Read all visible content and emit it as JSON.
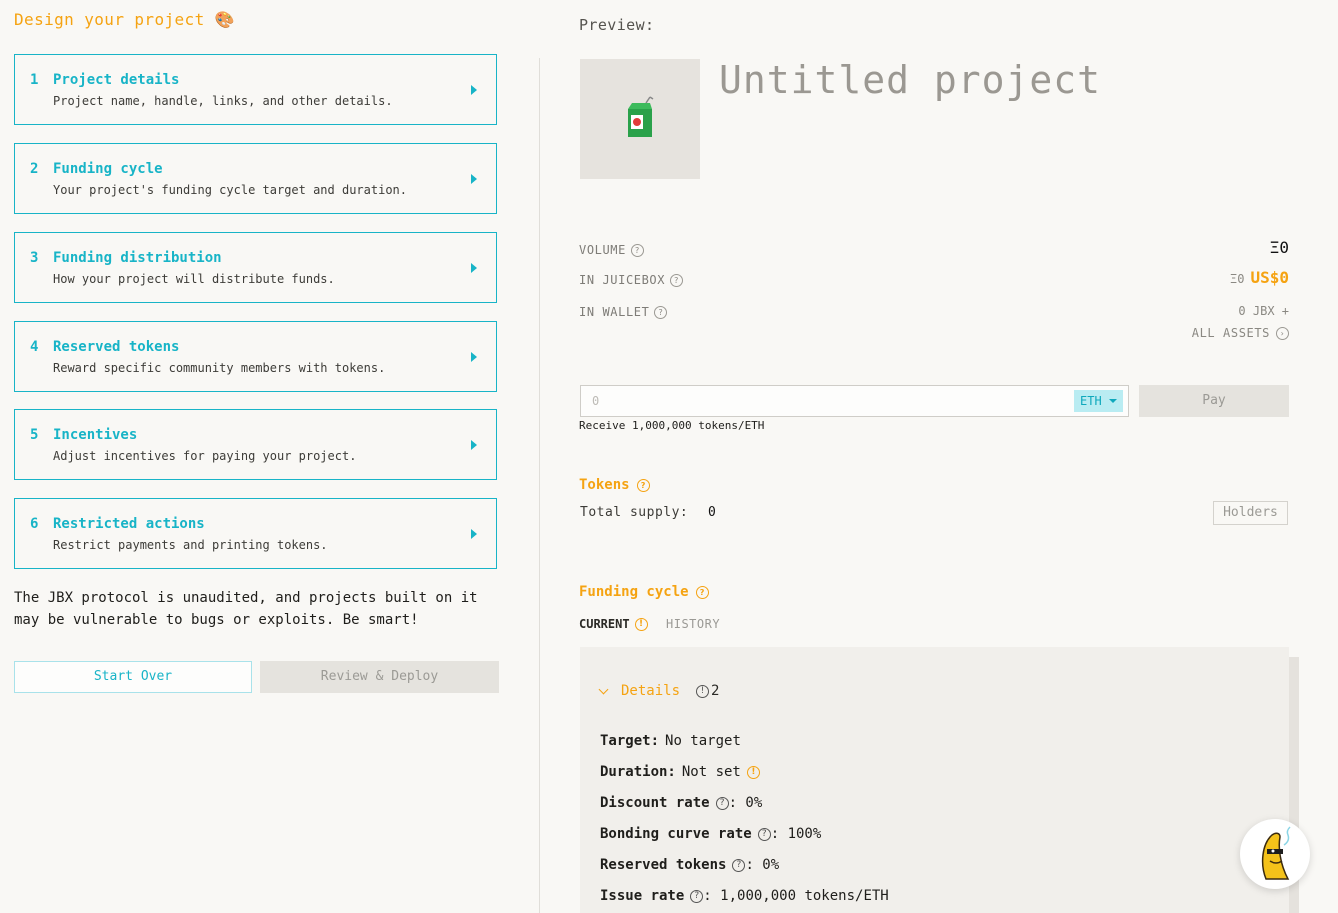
{
  "design": {
    "title": "Design your project",
    "title_emoji": "🎨",
    "steps": [
      {
        "num": "1",
        "title": "Project details",
        "desc": "Project name, handle, links, and other details."
      },
      {
        "num": "2",
        "title": "Funding cycle",
        "desc": "Your project's funding cycle target and duration."
      },
      {
        "num": "3",
        "title": "Funding distribution",
        "desc": "How your project will distribute funds."
      },
      {
        "num": "4",
        "title": "Reserved tokens",
        "desc": "Reward specific community members with tokens."
      },
      {
        "num": "5",
        "title": "Incentives",
        "desc": "Adjust incentives for paying your project."
      },
      {
        "num": "6",
        "title": "Restricted actions",
        "desc": "Restrict payments and printing tokens."
      }
    ],
    "warning": "The JBX protocol is unaudited, and projects built on it may be vulnerable to bugs or exploits. Be smart!",
    "start_over": "Start Over",
    "review_deploy": "Review & Deploy"
  },
  "preview": {
    "label": "Preview:",
    "project_title": "Untitled project",
    "volume_label": "VOLUME",
    "volume_value": "Ξ0",
    "juicebox_label": "IN JUICEBOX",
    "juicebox_eth": "Ξ0",
    "juicebox_usd": "US$0",
    "wallet_label": "IN WALLET",
    "wallet_value": "0 JBX +",
    "all_assets": "ALL ASSETS",
    "pay_placeholder": "0",
    "currency": "ETH",
    "pay_button": "Pay",
    "receive": "Receive 1,000,000 tokens/ETH",
    "tokens_title": "Tokens",
    "total_supply_label": "Total supply:",
    "total_supply_value": "0",
    "holders_button": "Holders",
    "funding_cycle_title": "Funding cycle",
    "tab_current": "CURRENT",
    "tab_history": "HISTORY",
    "details_label": "Details",
    "details_count": "2",
    "details": {
      "target_k": "Target:",
      "target_v": "No target",
      "duration_k": "Duration:",
      "duration_v": "Not set",
      "discount_k": "Discount rate",
      "discount_v": ": 0%",
      "bonding_k": "Bonding curve rate",
      "bonding_v": ": 100%",
      "reserved_k": "Reserved tokens",
      "reserved_v": ": 0%",
      "issue_k": "Issue rate",
      "issue_v": ": 1,000,000 tokens/ETH"
    }
  },
  "colors": {
    "accent_cyan": "#18b4c7",
    "accent_orange": "#f5a312",
    "background": "#f9f8f5"
  }
}
